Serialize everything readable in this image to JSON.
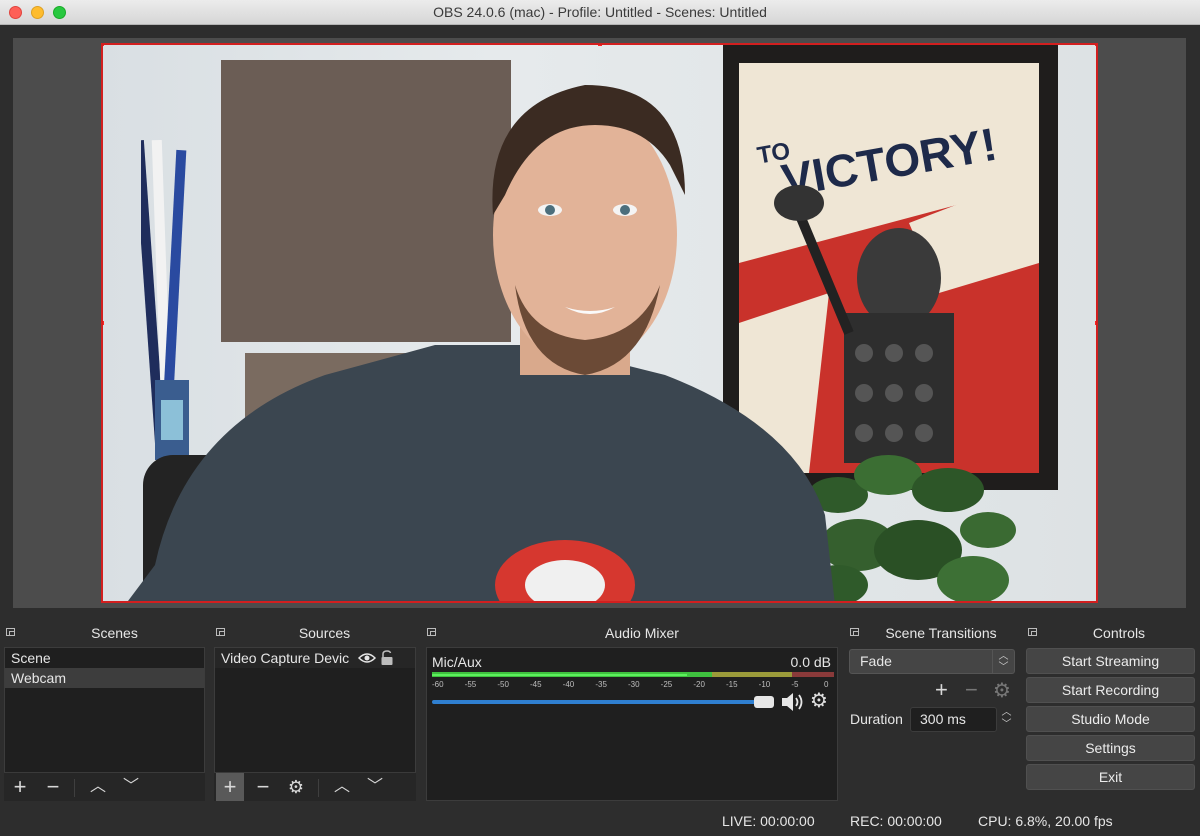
{
  "window": {
    "title": "OBS 24.0.6 (mac) - Profile: Untitled - Scenes: Untitled"
  },
  "scenes": {
    "title": "Scenes",
    "items": [
      "Scene",
      "Webcam"
    ],
    "selected": "Webcam"
  },
  "sources": {
    "title": "Sources",
    "items": [
      {
        "label": "Video Capture Devic",
        "visible_icon": "eye-icon",
        "lock_icon": "unlock-icon"
      }
    ]
  },
  "mixer": {
    "title": "Audio Mixer",
    "channel": "Mic/Aux",
    "level": "0.0 dB",
    "scale": [
      "-60",
      "-55",
      "-50",
      "-45",
      "-40",
      "-35",
      "-30",
      "-25",
      "-20",
      "-15",
      "-10",
      "-5",
      "0"
    ],
    "volume_fraction": 1.0
  },
  "transitions": {
    "title": "Scene Transitions",
    "selected": "Fade",
    "duration_label": "Duration",
    "duration_value": "300 ms"
  },
  "controls": {
    "title": "Controls",
    "buttons": [
      "Start Streaming",
      "Start Recording",
      "Studio Mode",
      "Settings",
      "Exit"
    ]
  },
  "statusbar": {
    "live": "LIVE: 00:00:00",
    "rec": "REC: 00:00:00",
    "cpu": "CPU: 6.8%, 20.00 fps"
  },
  "poster": {
    "text": "VICTORY!",
    "prefix": "TO"
  },
  "colors": {
    "accent": "#2f7fd0",
    "selection_border": "#d21f1f",
    "meter_green": "#3fc13f",
    "meter_yellow": "#c8c83c",
    "meter_red": "#c83c3c"
  }
}
